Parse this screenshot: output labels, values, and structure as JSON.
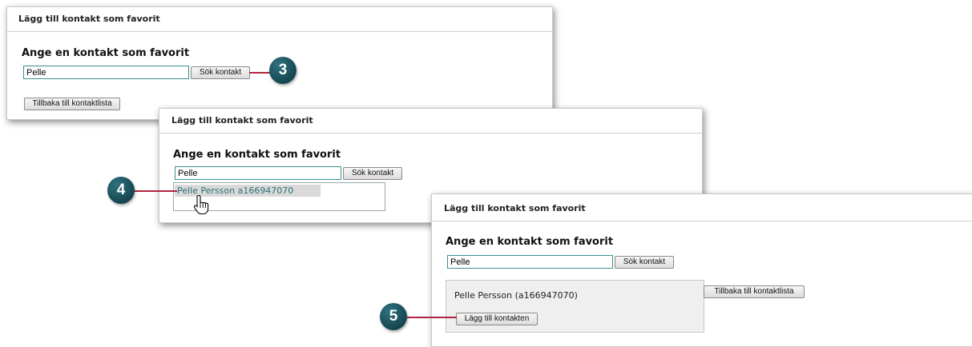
{
  "panel1": {
    "title": "Lägg till kontakt som favorit",
    "heading": "Ange en kontakt som favorit",
    "search_value": "Pelle",
    "search_button": "Sök kontakt",
    "back_button": "Tillbaka till kontaktlista",
    "step": "3"
  },
  "panel2": {
    "title": "Lägg till kontakt som favorit",
    "heading": "Ange en kontakt som favorit",
    "search_value": "Pelle",
    "search_button": "Sök kontakt",
    "suggestion": "Pelle Persson  a166947070",
    "step": "4"
  },
  "panel3": {
    "title": "Lägg till kontakt som favorit",
    "heading": "Ange en kontakt som favorit",
    "search_value": "Pelle",
    "search_button": "Sök kontakt",
    "result_text": "Pelle Persson (a166947070)",
    "add_button": "Lägg till kontakten",
    "back_button": "Tillbaka till kontaktlista",
    "step": "5"
  },
  "colors": {
    "badge": "#1f5a66",
    "callout": "#b0243f",
    "input_border": "#3a8f94"
  },
  "icons": {
    "cursor": "hand-pointer-icon"
  }
}
